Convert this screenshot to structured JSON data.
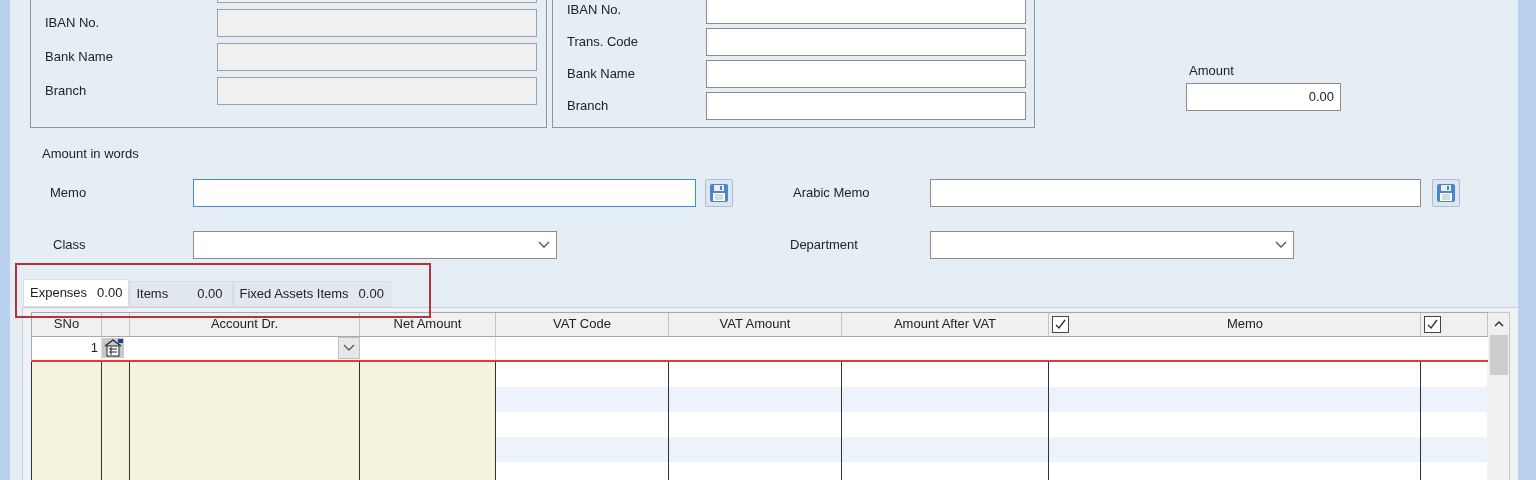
{
  "payee_bank": {
    "fields": [
      {
        "disabled": true
      },
      {
        "label": "IBAN No.",
        "disabled": true
      },
      {
        "label": "Bank Name",
        "disabled": true
      },
      {
        "label": "Branch",
        "disabled": true
      }
    ]
  },
  "transfer_bank": {
    "fields": [
      {
        "label": "IBAN No.",
        "disabled": false
      },
      {
        "label": "Trans. Code",
        "disabled": false
      },
      {
        "label": "Bank Name",
        "disabled": false
      },
      {
        "label": "Branch",
        "disabled": false
      }
    ]
  },
  "amount": {
    "label": "Amount",
    "value": "0.00"
  },
  "amount_in_words": {
    "label": "Amount in words"
  },
  "memo": {
    "label": "Memo",
    "focused": true
  },
  "arabic_memo": {
    "label": "Arabic Memo",
    "focused": false
  },
  "class": {
    "label": "Class"
  },
  "department": {
    "label": "Department"
  },
  "tabs": [
    {
      "label": "Expenses",
      "total": "0.00",
      "selected": true
    },
    {
      "label": "Items",
      "total": "0.00",
      "selected": false
    },
    {
      "label": "Fixed Assets Items",
      "total": "0.00",
      "selected": false
    }
  ],
  "grid": {
    "columns": [
      {
        "kind": "text",
        "label": "SNo"
      },
      {
        "kind": "blank"
      },
      {
        "kind": "text",
        "label": "Account Dr."
      },
      {
        "kind": "text",
        "label": "Net Amount"
      },
      {
        "kind": "text",
        "label": "VAT Code"
      },
      {
        "kind": "text",
        "label": "VAT Amount"
      },
      {
        "kind": "text",
        "label": "Amount After VAT"
      },
      {
        "kind": "check",
        "label": "Memo",
        "checked": true
      },
      {
        "kind": "check",
        "checked": true
      }
    ],
    "rows": [
      {
        "sno": "1"
      }
    ]
  }
}
